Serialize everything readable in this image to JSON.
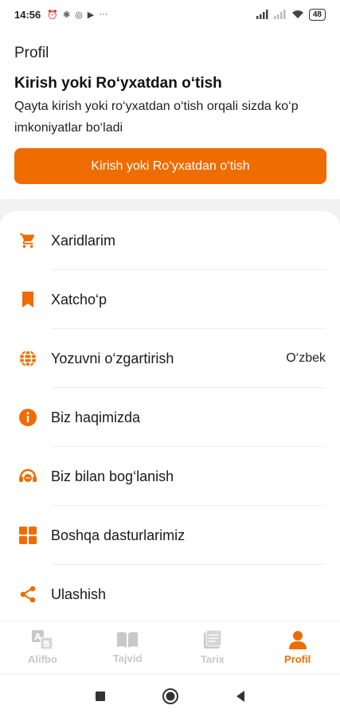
{
  "status_bar": {
    "time": "14:56",
    "battery": "48"
  },
  "header": {
    "title": "Profil",
    "login_heading": "Kirish yoki Ro‘yxatdan o‘tish",
    "login_description": "Qayta kirish yoki ro‘yxatdan o‘tish orqali sizda ko‘p imkoniyatlar bo‘ladi",
    "login_button": "Kirish yoki Ro‘yxatdan o‘tish"
  },
  "menu": {
    "items": [
      {
        "label": "Xaridlarim",
        "icon": "cart-icon"
      },
      {
        "label": "Xatcho‘p",
        "icon": "bookmark-icon"
      },
      {
        "label": "Yozuvni o‘zgartirish",
        "icon": "globe-icon",
        "value": "O‘zbek"
      },
      {
        "label": "Biz haqimizda",
        "icon": "info-icon"
      },
      {
        "label": "Biz bilan bog‘lanish",
        "icon": "support-icon"
      },
      {
        "label": "Boshqa dasturlarimiz",
        "icon": "apps-grid-icon"
      },
      {
        "label": "Ulashish",
        "icon": "share-icon"
      }
    ]
  },
  "bottom_nav": {
    "items": [
      {
        "label": "Alifbo",
        "icon": "alphabet-icon",
        "active": false
      },
      {
        "label": "Tajvid",
        "icon": "book-icon",
        "active": false
      },
      {
        "label": "Tarix",
        "icon": "history-book-icon",
        "active": false
      },
      {
        "label": "Profil",
        "icon": "person-icon",
        "active": true
      }
    ]
  },
  "colors": {
    "accent": "#ef6c00",
    "inactive": "#c8c8c8"
  }
}
